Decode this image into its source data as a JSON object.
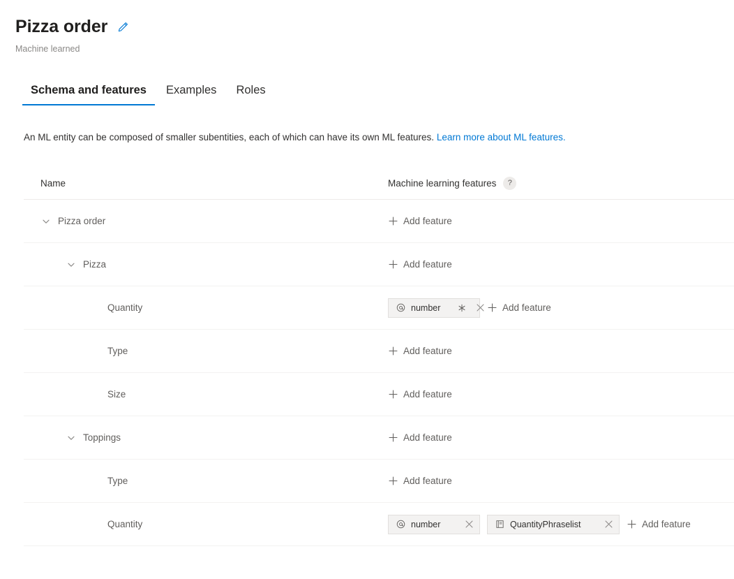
{
  "header": {
    "title": "Pizza order",
    "edit_icon": "pencil-icon",
    "subtitle": "Machine learned",
    "accent_color": "#0078d4"
  },
  "tabs": [
    {
      "label": "Schema and features",
      "active": true
    },
    {
      "label": "Examples",
      "active": false
    },
    {
      "label": "Roles",
      "active": false
    }
  ],
  "description": {
    "text": "An ML entity can be composed of smaller subentities, each of which can have its own ML features.",
    "link_text": "Learn more about ML features.",
    "link_color": "#0078d4"
  },
  "table": {
    "columns": {
      "name": "Name",
      "features": "Machine learning features",
      "help_icon": "?"
    },
    "add_feature_label": "Add feature",
    "rows": [
      {
        "name": "Pizza order",
        "level": 0,
        "expandable": true,
        "chevron": "chevron-down-icon",
        "features": []
      },
      {
        "name": "Pizza",
        "level": 1,
        "expandable": true,
        "chevron": "chevron-down-icon",
        "features": []
      },
      {
        "name": "Quantity",
        "level": 2,
        "expandable": false,
        "features": [
          {
            "label": "number",
            "icon": "at-sign-icon",
            "required_star": true,
            "close_icon": "close-icon"
          }
        ]
      },
      {
        "name": "Type",
        "level": 2,
        "expandable": false,
        "features": []
      },
      {
        "name": "Size",
        "level": 2,
        "expandable": false,
        "features": []
      },
      {
        "name": "Toppings",
        "level": 1,
        "expandable": true,
        "chevron": "chevron-down-icon",
        "features": []
      },
      {
        "name": "Type",
        "level": 2,
        "expandable": false,
        "features": []
      },
      {
        "name": "Quantity",
        "level": 2,
        "expandable": false,
        "features": [
          {
            "label": "number",
            "icon": "at-sign-icon",
            "required_star": false,
            "close_icon": "close-icon"
          },
          {
            "label": "QuantityPhraselist",
            "icon": "phraselist-book-icon",
            "required_star": false,
            "close_icon": "close-icon"
          }
        ]
      }
    ]
  }
}
